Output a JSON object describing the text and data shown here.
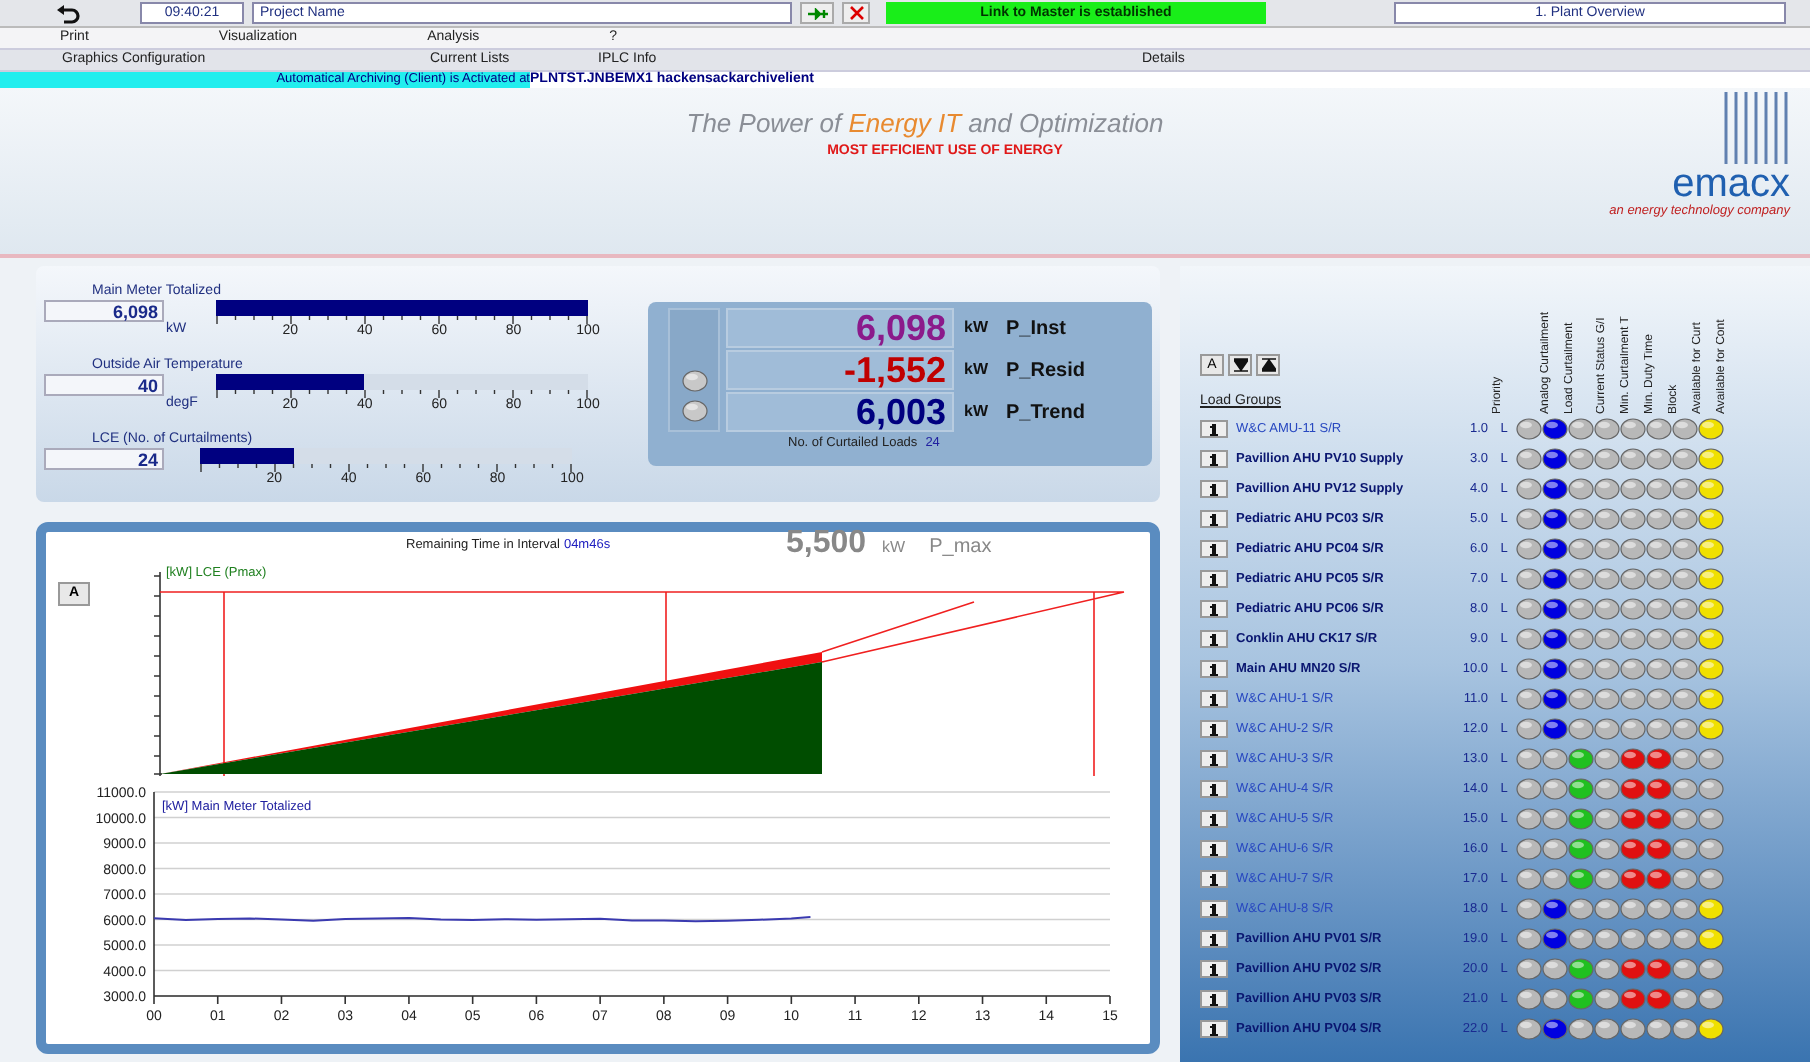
{
  "toolbar": {
    "time": "09:40:21",
    "project": "Project Name",
    "link_status": "Link to Master is established",
    "view": "1. Plant Overview"
  },
  "menu": [
    "Print",
    "Visualization",
    "Analysis",
    "?"
  ],
  "submenu": [
    "Graphics Configuration",
    "Current Lists",
    "IPLC Info",
    "Details"
  ],
  "archive": {
    "message": "Automatical Archiving (Client) is Activated at",
    "path": "PLNTST.JNBEMX1 hackensackarchivelient"
  },
  "banner": {
    "tagline": [
      {
        "text": "The Power of ",
        "accent": false
      },
      {
        "text": "Energy IT",
        "accent": true
      },
      {
        "text": " and Optimization",
        "accent": false
      }
    ],
    "slogan": "MOST EFFICIENT USE OF ENERGY",
    "logo": "emacx",
    "company": "an energy technology company"
  },
  "gauges": [
    {
      "label": "Main Meter Totalized",
      "value": "6,098",
      "unit": "kW",
      "level": 1.0,
      "ticks": [
        "20",
        "40",
        "60",
        "80",
        "100"
      ]
    },
    {
      "label": "Outside Air Temperature",
      "value": "40",
      "unit": "degF",
      "level": 0.4,
      "ticks": [
        "20",
        "40",
        "60",
        "80",
        "100"
      ]
    },
    {
      "label": "LCE (No. of Curtailments)",
      "value": "24",
      "level": 0.25,
      "ticks": [
        "20",
        "40",
        "60",
        "80",
        "100"
      ]
    }
  ],
  "power": {
    "readings": [
      {
        "value": "6,098",
        "unit": "kW",
        "name": "P_Inst",
        "color": "#8b1a8b"
      },
      {
        "value": "-1,552",
        "unit": "kW",
        "name": "P_Resid",
        "color": "#c00000"
      },
      {
        "value": "6,003",
        "unit": "kW",
        "name": "P_Trend",
        "color": "#00007f"
      }
    ],
    "curtailed_label": "No. of Curtailed Loads",
    "curtailed_count": "24"
  },
  "trend": {
    "button": "A",
    "series_label": "[kW] LCE (Pmax)",
    "remaining_label": "Remaining Time in Interval",
    "remaining": "04m46s",
    "pmax": "5,500",
    "pmax_unit": "kW",
    "pmax_name": "P_max"
  },
  "meter_chart": {
    "chart_data": {
      "type": "line",
      "grid": true,
      "title": "[kW] Main Meter Totalized",
      "x": [
        0,
        0.5,
        1,
        1.5,
        2,
        2.5,
        3,
        3.5,
        4,
        4.5,
        5,
        5.5,
        6,
        6.5,
        7,
        7.5,
        8,
        8.5,
        9,
        9.5,
        10,
        10.3
      ],
      "series": [
        {
          "color": "#3a3ab0",
          "values": [
            6050,
            5980,
            6020,
            6040,
            6000,
            5950,
            6020,
            6040,
            6060,
            6000,
            5980,
            6010,
            5990,
            6010,
            6030,
            5960,
            5960,
            5930,
            5950,
            5990,
            6040,
            6100
          ]
        }
      ],
      "xlim": [
        0,
        15
      ],
      "ylim": [
        3000,
        11000
      ],
      "xticks": [
        {
          "value": 0,
          "label": "00"
        },
        {
          "value": 1,
          "label": "01"
        },
        {
          "value": 2,
          "label": "02"
        },
        {
          "value": 3,
          "label": "03"
        },
        {
          "value": 4,
          "label": "04"
        },
        {
          "value": 5,
          "label": "05"
        },
        {
          "value": 6,
          "label": "06"
        },
        {
          "value": 7,
          "label": "07"
        },
        {
          "value": 8,
          "label": "08"
        },
        {
          "value": 9,
          "label": "09"
        },
        {
          "value": 10,
          "label": "10"
        },
        {
          "value": 11,
          "label": "11"
        },
        {
          "value": 12,
          "label": "12"
        },
        {
          "value": 13,
          "label": "13"
        },
        {
          "value": 14,
          "label": "14"
        },
        {
          "value": 15,
          "label": "15"
        }
      ],
      "yticks": [
        {
          "value": 3000,
          "label": "3000.0"
        },
        {
          "value": 4000,
          "label": "4000.0"
        },
        {
          "value": 5000,
          "label": "5000.0"
        },
        {
          "value": 6000,
          "label": "6000.0"
        },
        {
          "value": 7000,
          "label": "7000.0"
        },
        {
          "value": 8000,
          "label": "8000.0"
        },
        {
          "value": 9000,
          "label": "9000.0"
        },
        {
          "value": 10000,
          "label": "10000.0"
        },
        {
          "value": 11000,
          "label": "11000.0"
        }
      ]
    }
  },
  "load_groups": {
    "button": "A",
    "title": "Load Groups",
    "columns": [
      "Priority",
      "Analog Curtailment",
      "Load Curtailment",
      "Current Status G/I",
      "Min. Curtailment T",
      "Min. Duty Time",
      "Block",
      "Available for Curt",
      "Available for Cont"
    ],
    "rows": [
      {
        "name": "W&C AMU-11 S/R",
        "priority": "1.0",
        "mode": "L",
        "dimmed": true,
        "kind": "available"
      },
      {
        "name": "Pavillion AHU PV10 Supply",
        "priority": "3.0",
        "mode": "L",
        "dimmed": false,
        "kind": "available"
      },
      {
        "name": "Pavillion AHU PV12 Supply",
        "priority": "4.0",
        "mode": "L",
        "dimmed": false,
        "kind": "available"
      },
      {
        "name": "Pediatric AHU PC03 S/R",
        "priority": "5.0",
        "mode": "L",
        "dimmed": false,
        "kind": "available"
      },
      {
        "name": "Pediatric AHU PC04 S/R",
        "priority": "6.0",
        "mode": "L",
        "dimmed": false,
        "kind": "available"
      },
      {
        "name": "Pediatric AHU PC05 S/R",
        "priority": "7.0",
        "mode": "L",
        "dimmed": false,
        "kind": "available"
      },
      {
        "name": "Pediatric AHU PC06 S/R",
        "priority": "8.0",
        "mode": "L",
        "dimmed": false,
        "kind": "available"
      },
      {
        "name": "Conklin AHU CK17 S/R",
        "priority": "9.0",
        "mode": "L",
        "dimmed": false,
        "kind": "available"
      },
      {
        "name": "Main AHU MN20 S/R",
        "priority": "10.0",
        "mode": "L",
        "dimmed": false,
        "kind": "available"
      },
      {
        "name": "W&C AHU-1 S/R",
        "priority": "11.0",
        "mode": "L",
        "dimmed": true,
        "kind": "available"
      },
      {
        "name": "W&C AHU-2 S/R",
        "priority": "12.0",
        "mode": "L",
        "dimmed": true,
        "kind": "available"
      },
      {
        "name": "W&C AHU-3 S/R",
        "priority": "13.0",
        "mode": "L",
        "dimmed": true,
        "kind": "curtailed"
      },
      {
        "name": "W&C AHU-4 S/R",
        "priority": "14.0",
        "mode": "L",
        "dimmed": true,
        "kind": "curtailed"
      },
      {
        "name": "W&C AHU-5 S/R",
        "priority": "15.0",
        "mode": "L",
        "dimmed": true,
        "kind": "curtailed"
      },
      {
        "name": "W&C AHU-6 S/R",
        "priority": "16.0",
        "mode": "L",
        "dimmed": true,
        "kind": "curtailed"
      },
      {
        "name": "W&C AHU-7 S/R",
        "priority": "17.0",
        "mode": "L",
        "dimmed": true,
        "kind": "curtailed"
      },
      {
        "name": "W&C AHU-8 S/R",
        "priority": "18.0",
        "mode": "L",
        "dimmed": true,
        "kind": "available"
      },
      {
        "name": "Pavillion AHU PV01 S/R",
        "priority": "19.0",
        "mode": "L",
        "dimmed": false,
        "kind": "available"
      },
      {
        "name": "Pavillion AHU PV02 S/R",
        "priority": "20.0",
        "mode": "L",
        "dimmed": false,
        "kind": "curtailed"
      },
      {
        "name": "Pavillion AHU PV03 S/R",
        "priority": "21.0",
        "mode": "L",
        "dimmed": false,
        "kind": "curtailed"
      },
      {
        "name": "Pavillion AHU PV04 S/R",
        "priority": "22.0",
        "mode": "L",
        "dimmed": false,
        "kind": "available"
      }
    ]
  }
}
